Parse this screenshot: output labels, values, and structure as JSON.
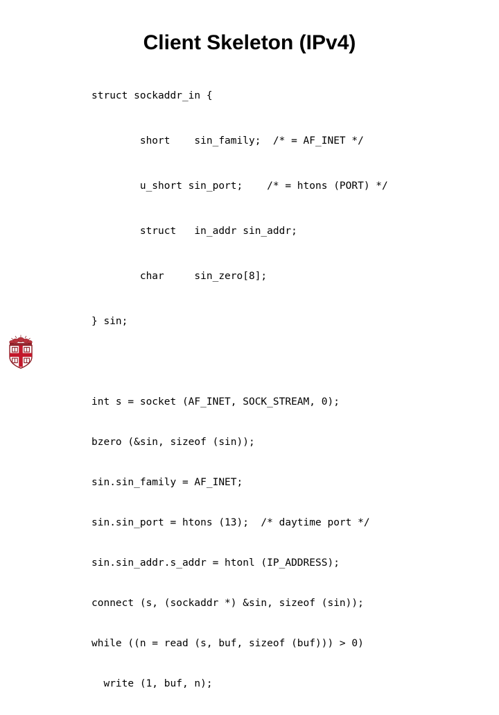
{
  "slide": {
    "title": "Client Skeleton (IPv4)",
    "background_color": "#ffffff",
    "text_color": "#000000"
  },
  "code": {
    "struct_block": [
      "struct sockaddr_in {",
      "        short    sin_family;  /* = AF_INET */",
      "        u_short sin_port;    /* = htons (PORT) */",
      "        struct   in_addr sin_addr;",
      "        char     sin_zero[8];",
      "} sin;"
    ],
    "calls_block": [
      "int s = socket (AF_INET, SOCK_STREAM, 0);",
      "bzero (&sin, sizeof (sin));",
      "sin.sin_family = AF_INET;",
      "sin.sin_port = htons (13);  /* daytime port */",
      "sin.sin_addr.s_addr = htonl (IP_ADDRESS);",
      "connect (s, (sockaddr *) &sin, sizeof (sin));",
      "while ((n = read (s, buf, sizeof (buf))) > 0)",
      "  write (1, buf, n);"
    ]
  },
  "logo": {
    "name": "brown-university-crest",
    "shield_color": "#ffffff",
    "cross_color": "#c2182b",
    "outline_color": "#8b1a22",
    "crest_color": "#b8323c"
  }
}
